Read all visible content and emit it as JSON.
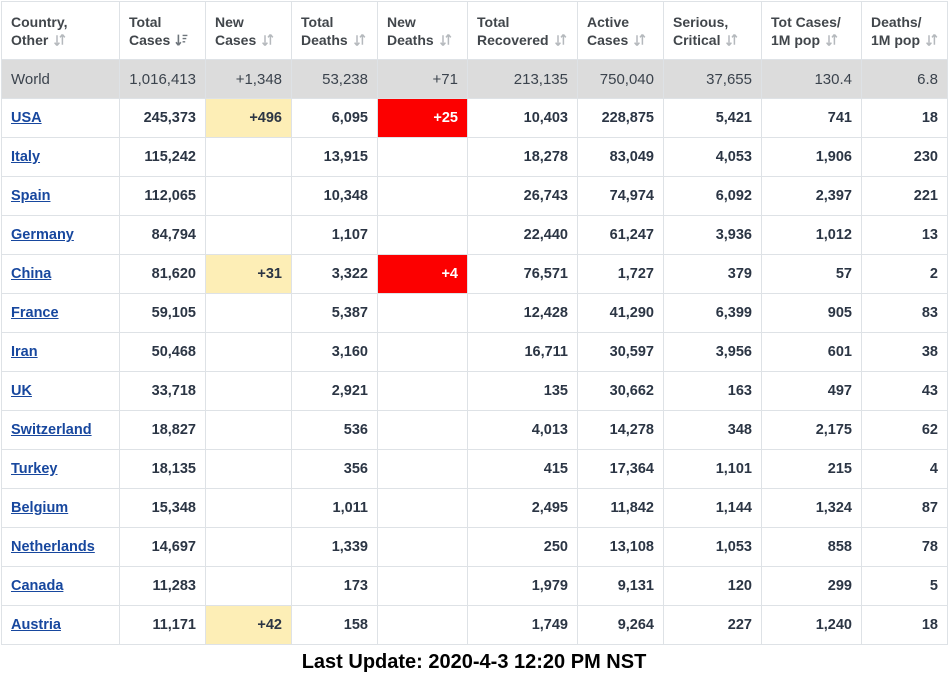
{
  "table": {
    "columns": [
      {
        "label_line1": "Country,",
        "label_line2": "Other",
        "sort_icon": "sort-both-icon",
        "sort_state": "none",
        "align": "left"
      },
      {
        "label_line1": "Total",
        "label_line2": "Cases",
        "sort_icon": "sort-desc-icon",
        "sort_state": "desc",
        "align": "right"
      },
      {
        "label_line1": "New",
        "label_line2": "Cases",
        "sort_icon": "sort-both-icon",
        "sort_state": "none",
        "align": "right"
      },
      {
        "label_line1": "Total",
        "label_line2": "Deaths",
        "sort_icon": "sort-both-icon",
        "sort_state": "none",
        "align": "right"
      },
      {
        "label_line1": "New",
        "label_line2": "Deaths",
        "sort_icon": "sort-both-icon",
        "sort_state": "none",
        "align": "right"
      },
      {
        "label_line1": "Total",
        "label_line2": "Recovered",
        "sort_icon": "sort-both-icon",
        "sort_state": "none",
        "align": "right"
      },
      {
        "label_line1": "Active",
        "label_line2": "Cases",
        "sort_icon": "sort-both-icon",
        "sort_state": "none",
        "align": "right"
      },
      {
        "label_line1": "Serious,",
        "label_line2": "Critical",
        "sort_icon": "sort-both-icon",
        "sort_state": "none",
        "align": "right"
      },
      {
        "label_line1": "Tot Cases/",
        "label_line2": "1M pop",
        "sort_icon": "sort-both-icon",
        "sort_state": "none",
        "align": "right"
      },
      {
        "label_line1": "Deaths/",
        "label_line2": "1M pop",
        "sort_icon": "sort-both-icon",
        "sort_state": "none",
        "align": "right"
      }
    ],
    "rows": [
      {
        "country": "World",
        "is_world": true,
        "is_link": false,
        "total_cases": "1,016,413",
        "new_cases": "+1,348",
        "total_deaths": "53,238",
        "new_deaths": "+71",
        "total_recovered": "213,135",
        "active_cases": "750,040",
        "serious_critical": "37,655",
        "tot_cases_1m": "130.4",
        "deaths_1m": "6.8"
      },
      {
        "country": "USA",
        "is_world": false,
        "is_link": true,
        "total_cases": "245,373",
        "new_cases": "+496",
        "total_deaths": "6,095",
        "new_deaths": "+25",
        "total_recovered": "10,403",
        "active_cases": "228,875",
        "serious_critical": "5,421",
        "tot_cases_1m": "741",
        "deaths_1m": "18"
      },
      {
        "country": "Italy",
        "is_world": false,
        "is_link": true,
        "total_cases": "115,242",
        "new_cases": "",
        "total_deaths": "13,915",
        "new_deaths": "",
        "total_recovered": "18,278",
        "active_cases": "83,049",
        "serious_critical": "4,053",
        "tot_cases_1m": "1,906",
        "deaths_1m": "230"
      },
      {
        "country": "Spain",
        "is_world": false,
        "is_link": true,
        "total_cases": "112,065",
        "new_cases": "",
        "total_deaths": "10,348",
        "new_deaths": "",
        "total_recovered": "26,743",
        "active_cases": "74,974",
        "serious_critical": "6,092",
        "tot_cases_1m": "2,397",
        "deaths_1m": "221"
      },
      {
        "country": "Germany",
        "is_world": false,
        "is_link": true,
        "total_cases": "84,794",
        "new_cases": "",
        "total_deaths": "1,107",
        "new_deaths": "",
        "total_recovered": "22,440",
        "active_cases": "61,247",
        "serious_critical": "3,936",
        "tot_cases_1m": "1,012",
        "deaths_1m": "13"
      },
      {
        "country": "China",
        "is_world": false,
        "is_link": true,
        "total_cases": "81,620",
        "new_cases": "+31",
        "total_deaths": "3,322",
        "new_deaths": "+4",
        "total_recovered": "76,571",
        "active_cases": "1,727",
        "serious_critical": "379",
        "tot_cases_1m": "57",
        "deaths_1m": "2"
      },
      {
        "country": "France",
        "is_world": false,
        "is_link": true,
        "total_cases": "59,105",
        "new_cases": "",
        "total_deaths": "5,387",
        "new_deaths": "",
        "total_recovered": "12,428",
        "active_cases": "41,290",
        "serious_critical": "6,399",
        "tot_cases_1m": "905",
        "deaths_1m": "83"
      },
      {
        "country": "Iran",
        "is_world": false,
        "is_link": true,
        "total_cases": "50,468",
        "new_cases": "",
        "total_deaths": "3,160",
        "new_deaths": "",
        "total_recovered": "16,711",
        "active_cases": "30,597",
        "serious_critical": "3,956",
        "tot_cases_1m": "601",
        "deaths_1m": "38"
      },
      {
        "country": "UK",
        "is_world": false,
        "is_link": true,
        "total_cases": "33,718",
        "new_cases": "",
        "total_deaths": "2,921",
        "new_deaths": "",
        "total_recovered": "135",
        "active_cases": "30,662",
        "serious_critical": "163",
        "tot_cases_1m": "497",
        "deaths_1m": "43"
      },
      {
        "country": "Switzerland",
        "is_world": false,
        "is_link": true,
        "total_cases": "18,827",
        "new_cases": "",
        "total_deaths": "536",
        "new_deaths": "",
        "total_recovered": "4,013",
        "active_cases": "14,278",
        "serious_critical": "348",
        "tot_cases_1m": "2,175",
        "deaths_1m": "62"
      },
      {
        "country": "Turkey",
        "is_world": false,
        "is_link": true,
        "total_cases": "18,135",
        "new_cases": "",
        "total_deaths": "356",
        "new_deaths": "",
        "total_recovered": "415",
        "active_cases": "17,364",
        "serious_critical": "1,101",
        "tot_cases_1m": "215",
        "deaths_1m": "4"
      },
      {
        "country": "Belgium",
        "is_world": false,
        "is_link": true,
        "total_cases": "15,348",
        "new_cases": "",
        "total_deaths": "1,011",
        "new_deaths": "",
        "total_recovered": "2,495",
        "active_cases": "11,842",
        "serious_critical": "1,144",
        "tot_cases_1m": "1,324",
        "deaths_1m": "87"
      },
      {
        "country": "Netherlands",
        "is_world": false,
        "is_link": true,
        "total_cases": "14,697",
        "new_cases": "",
        "total_deaths": "1,339",
        "new_deaths": "",
        "total_recovered": "250",
        "active_cases": "13,108",
        "serious_critical": "1,053",
        "tot_cases_1m": "858",
        "deaths_1m": "78"
      },
      {
        "country": "Canada",
        "is_world": false,
        "is_link": true,
        "total_cases": "11,283",
        "new_cases": "",
        "total_deaths": "173",
        "new_deaths": "",
        "total_recovered": "1,979",
        "active_cases": "9,131",
        "serious_critical": "120",
        "tot_cases_1m": "299",
        "deaths_1m": "5"
      },
      {
        "country": "Austria",
        "is_world": false,
        "is_link": true,
        "total_cases": "11,171",
        "new_cases": "+42",
        "total_deaths": "158",
        "new_deaths": "",
        "total_recovered": "1,749",
        "active_cases": "9,264",
        "serious_critical": "227",
        "tot_cases_1m": "1,240",
        "deaths_1m": "18"
      }
    ],
    "highlights": {
      "new_cases_bg": "#fdeeb6",
      "new_deaths_bg": "#fc0000",
      "new_deaths_text": "#ffffff",
      "world_row_bg": "#dcdcdc",
      "link_color": "#17479e",
      "red_underline": "#cc0000"
    }
  },
  "footer": {
    "last_update": "Last Update: 2020-4-3 12:20 PM NST"
  }
}
